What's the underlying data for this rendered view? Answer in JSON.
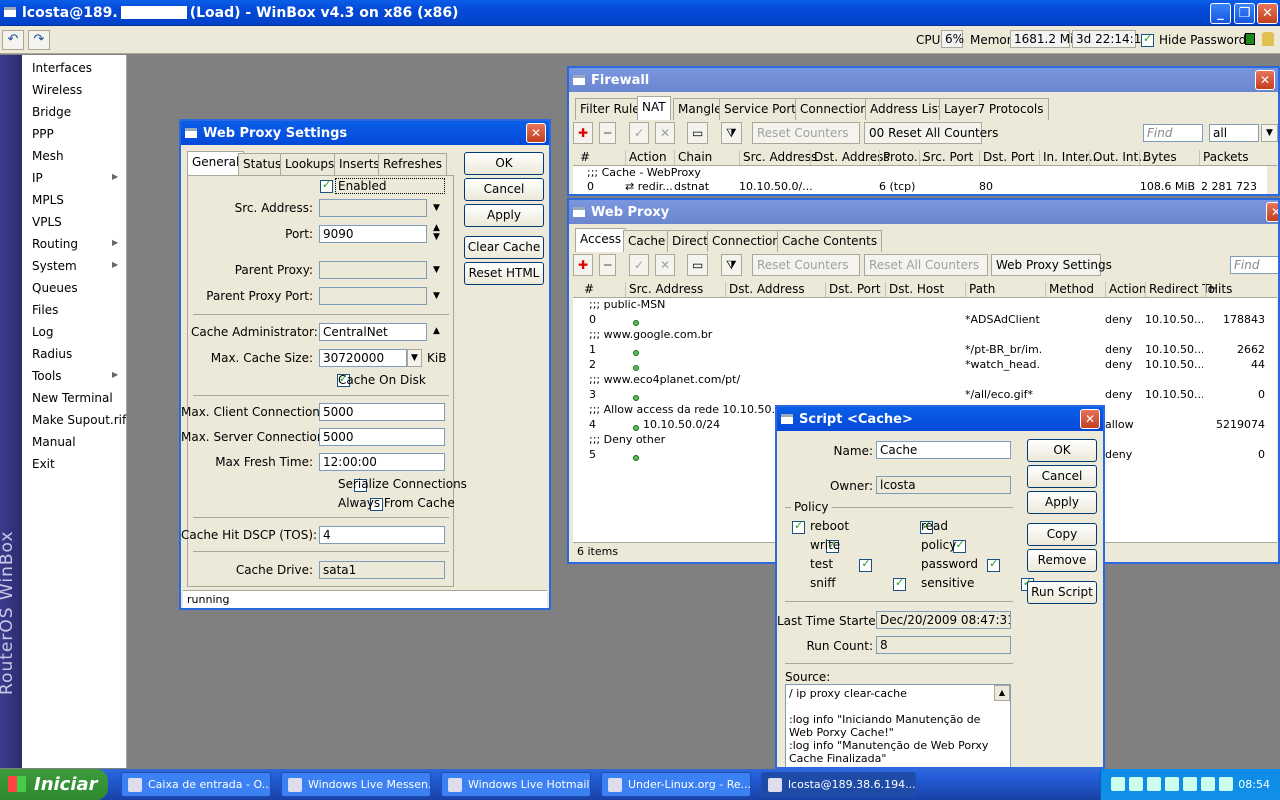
{
  "window": {
    "title_user": "lcosta@189.",
    "title_rest": "(Load) - WinBox v4.3 on x86 (x86)"
  },
  "toolbar": {
    "cpu_label": "CPU:",
    "cpu": "6%",
    "mem_label": "Memory:",
    "mem": "1681.2 MiB",
    "uptime": "3d 22:14:11",
    "hide_passwords": "Hide Passwords"
  },
  "brand": "RouterOS WinBox",
  "menu": [
    "Interfaces",
    "Wireless",
    "Bridge",
    "PPP",
    "Mesh",
    "IP",
    "MPLS",
    "VPLS",
    "Routing",
    "System",
    "Queues",
    "Files",
    "Log",
    "Radius",
    "Tools",
    "New Terminal",
    "Make Supout.rif",
    "Manual",
    "Exit"
  ],
  "proxy": {
    "title": "Web Proxy Settings",
    "tabs": [
      "General",
      "Status",
      "Lookups",
      "Inserts",
      "Refreshes"
    ],
    "enabled": "Enabled",
    "src_address_label": "Src. Address:",
    "src_address": "",
    "port_label": "Port:",
    "port": "9090",
    "parent_proxy_label": "Parent Proxy:",
    "parent_proxy": "",
    "parent_proxy_port_label": "Parent Proxy Port:",
    "parent_proxy_port": "",
    "cache_admin_label": "Cache Administrator:",
    "cache_admin": "CentralNet",
    "max_cache_label": "Max. Cache Size:",
    "max_cache": "30720000",
    "max_cache_unit": "KiB",
    "cache_on_disk": "Cache On Disk",
    "max_client_label": "Max. Client Connections:",
    "max_client": "5000",
    "max_server_label": "Max. Server Connections:",
    "max_server": "5000",
    "fresh_label": "Max Fresh Time:",
    "fresh": "12:00:00",
    "serialize": "Serialize Connections",
    "always_cache": "Always From Cache",
    "dscp_label": "Cache Hit DSCP (TOS):",
    "dscp": "4",
    "drive_label": "Cache Drive:",
    "drive": "sata1",
    "status": "running",
    "buttons": [
      "OK",
      "Cancel",
      "Apply",
      "Clear Cache",
      "Reset HTML"
    ]
  },
  "firewall": {
    "title": "Firewall",
    "tabs": [
      "Filter Rules",
      "NAT",
      "Mangle",
      "Service Ports",
      "Connections",
      "Address Lists",
      "Layer7 Protocols"
    ],
    "reset_counters": "Reset Counters",
    "reset_all": "Reset All Counters",
    "find": "Find",
    "filter": "all",
    "cols": [
      "#",
      "Action",
      "Chain",
      "Src. Address",
      "Dst. Address",
      "Proto...",
      "Src. Port",
      "Dst. Port",
      "In. Inter...",
      "Out. Int...",
      "Bytes",
      "Packets"
    ],
    "comment": ";;; Cache - WebProxy",
    "row": {
      "num": "0",
      "action": "redir...",
      "chain": "dstnat",
      "src": "10.10.50.0/...",
      "proto": "6 (tcp)",
      "dst_port": "80",
      "bytes": "108.6 MiB",
      "packets": "2 281 723"
    }
  },
  "webproxy": {
    "title": "Web Proxy",
    "tabs": [
      "Access",
      "Cache",
      "Direct",
      "Connections",
      "Cache Contents"
    ],
    "reset_counters": "Reset Counters",
    "reset_all": "Reset All Counters",
    "settings": "Web Proxy Settings",
    "find": "Find",
    "cols": [
      "#",
      "Src. Address",
      "Dst. Address",
      "Dst. Port",
      "Dst. Host",
      "Path",
      "Method",
      "Action",
      "Redirect To",
      "Hits"
    ],
    "rows": [
      {
        "comment": ";;; public-MSN"
      },
      {
        "num": "0",
        "src": "",
        "path": "*ADSAdClient...",
        "action": "deny",
        "redirect": "10.10.50...",
        "hits": "178843"
      },
      {
        "comment": ";;; www.google.com.br"
      },
      {
        "num": "1",
        "src": "",
        "path": "*/pt-BR_br/im...",
        "action": "deny",
        "redirect": "10.10.50...",
        "hits": "2662"
      },
      {
        "num": "2",
        "src": "",
        "path": "*watch_head...",
        "action": "deny",
        "redirect": "10.10.50...",
        "hits": "44"
      },
      {
        "comment": ";;; www.eco4planet.com/pt/"
      },
      {
        "num": "3",
        "src": "",
        "path": "*/all/eco.gif*",
        "action": "deny",
        "redirect": "10.10.50...",
        "hits": "0"
      },
      {
        "comment": ";;; Allow access da rede 10.10.50.0/24"
      },
      {
        "num": "4",
        "src": "10.10.50.0/24",
        "path": "",
        "action": "allow",
        "redirect": "",
        "hits": "5219074"
      },
      {
        "comment": ";;; Deny other"
      },
      {
        "num": "5",
        "src": "",
        "path": "",
        "action": "deny",
        "redirect": "",
        "hits": "0"
      }
    ],
    "status": "6 items"
  },
  "script": {
    "title": "Script <Cache>",
    "name_label": "Name:",
    "name": "Cache",
    "owner_label": "Owner:",
    "owner": "lcosta",
    "policy_label": "Policy",
    "policies": [
      "reboot",
      "read",
      "write",
      "policy",
      "test",
      "password",
      "sniff",
      "sensitive"
    ],
    "last_label": "Last Time Started:",
    "last": "Dec/20/2009 08:47:31",
    "count_label": "Run Count:",
    "count": "8",
    "source_label": "Source:",
    "source": "/ ip proxy clear-cache\n\n:log info \"Iniciando Manutenção de Web Porxy Cache!\"\n:log info \"Manutenção de Web Porxy Cache Finalizada\"",
    "buttons": [
      "OK",
      "Cancel",
      "Apply",
      "Copy",
      "Remove",
      "Run Script"
    ]
  },
  "taskbar": {
    "start": "Iniciar",
    "tasks": [
      "Caixa de entrada - O...",
      "Windows Live Messen...",
      "Windows Live Hotmail...",
      "Under-Linux.org - Re...",
      "lcosta@189.38.6.194...."
    ],
    "clock": "08:54"
  },
  "colors": {
    "titlebar": "#0449d8",
    "desktop": "#808080",
    "ui": "#ece9d8",
    "leftstrip": "#2c2c70"
  }
}
